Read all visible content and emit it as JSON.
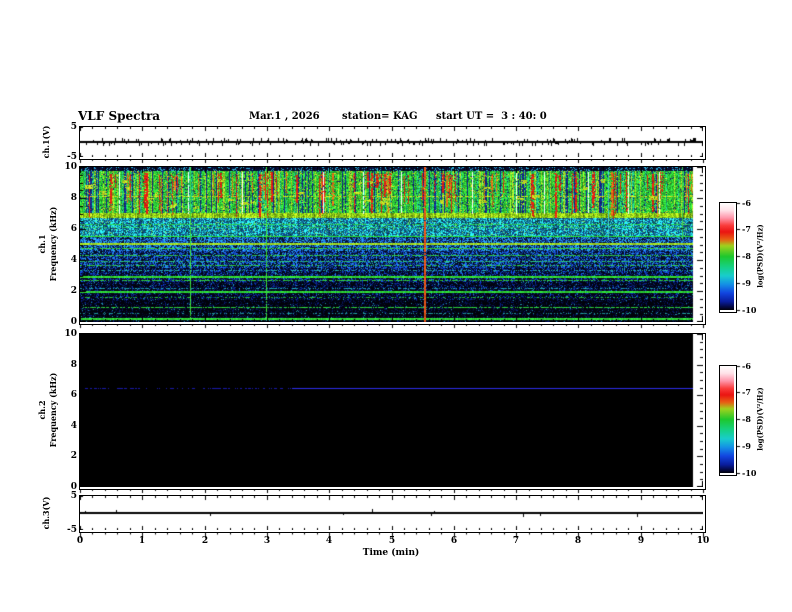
{
  "header": {
    "title": "VLF Spectra",
    "date": "Mar.1 , 2026",
    "station": "station= KAG",
    "start_ut": "start UT =  3 : 40: 0"
  },
  "axes": {
    "time_ticks": [
      "0",
      "1",
      "2",
      "3",
      "4",
      "5",
      "6",
      "7",
      "8",
      "9",
      "10"
    ],
    "time_label": "Time (min)",
    "freq_ticks": [
      "10",
      "8",
      "6",
      "4",
      "2",
      "0"
    ],
    "volt_max": "5",
    "volt_min": "-5"
  },
  "panels": {
    "ch1v": {
      "label": "ch.1(V)"
    },
    "ch1": {
      "label_line1": "ch.1",
      "label_line2": "Frequency (kHz)"
    },
    "ch2": {
      "label_line1": "ch.2",
      "label_line2": "Frequency (kHz)"
    },
    "ch3v": {
      "label": "ch.3(V)"
    }
  },
  "colorbar": {
    "ticks": [
      "-6",
      "-7",
      "-8",
      "-9",
      "-10"
    ],
    "label": "log(PSD)(V²/Hz)"
  },
  "chart_data": [
    {
      "id": "ch1_voltage",
      "type": "line",
      "title": "ch.1(V)",
      "x_range": [
        0,
        10
      ],
      "y_range": [
        -5,
        5
      ],
      "baseline_v": 0,
      "description": "flat trace at 0 V with dense small noise spikes",
      "noise_p": 0.32,
      "data_end_min": 10
    },
    {
      "id": "ch1_spectrogram",
      "type": "heatmap",
      "x_range": [
        0,
        10
      ],
      "y_range": [
        0,
        10
      ],
      "y_label": "ch.1 Frequency (kHz)",
      "data_end_min": 9.84,
      "bands": [
        {
          "f_hi": 10,
          "f_lo": 9.72,
          "base": [
            6,
            10,
            45
          ],
          "variation": 0.5,
          "fleck_p": 0.18,
          "fleck": [
            40,
            170,
            210
          ],
          "dark_p": 0,
          "dark": [
            0,
            0,
            0
          ]
        },
        {
          "f_hi": 9.72,
          "f_lo": 7.05,
          "active": true
        },
        {
          "f_hi": 7.05,
          "f_lo": 6.72,
          "base": [
            150,
            215,
            25
          ],
          "variation": 0.35,
          "fleck_p": 0,
          "fleck": [
            0,
            0,
            0
          ],
          "dark_p": 0,
          "dark": [
            0,
            0,
            0
          ]
        },
        {
          "f_hi": 6.72,
          "f_lo": 5.55,
          "base": [
            28,
            175,
            190
          ],
          "variation": 0.75,
          "fleck_p": 0.05,
          "fleck": [
            120,
            220,
            120
          ],
          "dark_p": 0.22,
          "dark": [
            15,
            70,
            150
          ]
        },
        {
          "f_hi": 5.55,
          "f_lo": 4.6,
          "base": [
            25,
            95,
            205
          ],
          "variation": 0.8,
          "fleck_p": 0.08,
          "fleck": [
            45,
            195,
            210
          ],
          "dark_p": 0.18,
          "dark": [
            4,
            10,
            40
          ]
        },
        {
          "f_hi": 4.6,
          "f_lo": 3.5,
          "base": [
            18,
            65,
            170
          ],
          "variation": 0.85,
          "fleck_p": 0.05,
          "fleck": [
            40,
            180,
            200
          ],
          "dark_p": 0.28,
          "dark": [
            3,
            8,
            30
          ]
        },
        {
          "f_hi": 3.5,
          "f_lo": 2.55,
          "base": [
            10,
            40,
            125
          ],
          "variation": 0.9,
          "fleck_p": 0.04,
          "fleck": [
            35,
            160,
            190
          ],
          "dark_p": 0.38,
          "dark": [
            2,
            5,
            22
          ]
        },
        {
          "f_hi": 2.55,
          "f_lo": 1.45,
          "base": [
            7,
            25,
            95
          ],
          "variation": 0.9,
          "fleck_p": 0.03,
          "fleck": [
            30,
            150,
            180
          ],
          "dark_p": 0.5,
          "dark": [
            1,
            3,
            15
          ]
        },
        {
          "f_hi": 1.45,
          "f_lo": 0,
          "base": [
            4,
            14,
            60
          ],
          "variation": 0.9,
          "fleck_p": 0.02,
          "fleck": [
            30,
            140,
            170
          ],
          "dark_p": 0.62,
          "dark": [
            1,
            2,
            10
          ]
        }
      ],
      "active_band": {
        "col_types": [
          {
            "p": 0.12,
            "rgb": [
              20,
              40,
              140
            ]
          },
          {
            "p": 0.3,
            "rgb": [
              30,
              185,
              130
            ]
          },
          {
            "p": 0.45,
            "rgb": [
              150,
              215,
              40
            ]
          },
          {
            "p": 1.01,
            "rgb": [
              45,
              200,
              55
            ]
          }
        ],
        "yellow_p": 0.06,
        "yellow": [
          200,
          225,
          35
        ],
        "navy_p": 0.05,
        "navy": [
          15,
          30,
          110
        ]
      },
      "h_lines": [
        {
          "f": 8.1,
          "rgb": [
            210,
            220,
            30
          ],
          "th": 1,
          "p": 0.55
        },
        {
          "f": 6.35,
          "rgb": [
            40,
            210,
            80
          ],
          "th": 1,
          "p": 0.7
        },
        {
          "f": 6.1,
          "rgb": [
            40,
            200,
            90
          ],
          "th": 1,
          "p": 0.5
        },
        {
          "f": 5.55,
          "rgb": [
            40,
            225,
            50
          ],
          "th": 1,
          "p": 1
        },
        {
          "f": 5.05,
          "rgb": [
            165,
            225,
            35
          ],
          "th": 2,
          "p": 1
        },
        {
          "f": 4.75,
          "rgb": [
            50,
            210,
            60
          ],
          "th": 1,
          "p": 0.8
        },
        {
          "f": 4.35,
          "rgb": [
            45,
            200,
            70
          ],
          "th": 1,
          "p": 0.8
        },
        {
          "f": 3.95,
          "rgb": [
            40,
            190,
            120
          ],
          "th": 1,
          "p": 0.7
        },
        {
          "f": 3.65,
          "rgb": [
            45,
            205,
            65
          ],
          "th": 1,
          "p": 0.6
        },
        {
          "f": 3.35,
          "rgb": [
            35,
            170,
            170
          ],
          "th": 1,
          "p": 0.5
        },
        {
          "f": 2.9,
          "rgb": [
            50,
            220,
            50
          ],
          "th": 2,
          "p": 1
        },
        {
          "f": 2.7,
          "rgb": [
            45,
            200,
            60
          ],
          "th": 1,
          "p": 0.7
        },
        {
          "f": 2.2,
          "rgb": [
            30,
            160,
            170
          ],
          "th": 1,
          "p": 0.45
        },
        {
          "f": 1.95,
          "rgb": [
            45,
            215,
            55
          ],
          "th": 2,
          "p": 1
        },
        {
          "f": 1.6,
          "rgb": [
            40,
            180,
            60
          ],
          "th": 1,
          "p": 0.4
        },
        {
          "f": 0.95,
          "rgb": [
            45,
            205,
            60
          ],
          "th": 1,
          "p": 0.75
        },
        {
          "f": 0.6,
          "rgb": [
            30,
            150,
            150
          ],
          "th": 1,
          "p": 0.35
        },
        {
          "f": 0.2,
          "rgb": [
            50,
            225,
            60
          ],
          "th": 2,
          "p": 1
        }
      ],
      "red_streaks": {
        "count": 90,
        "f_top": [
          9.45,
          9.7
        ],
        "f_bot": [
          6.6,
          8.8
        ],
        "red": [
          225,
          32,
          18
        ],
        "orange": [
          232,
          115,
          22
        ],
        "orange_ratio": 0.3
      },
      "white_gap_times": [
        0.62,
        1.73,
        2.6,
        3.9,
        4.55,
        5.15,
        6.3,
        7.0,
        7.45,
        8.15,
        8.8,
        9.3
      ],
      "white_gap_band": [
        7.05,
        9.7
      ],
      "yellow_blobs": {
        "count": 30,
        "f_range": [
          7.4,
          9.4
        ],
        "rgb": [
          200,
          225,
          35
        ]
      },
      "v_events": [
        {
          "t": 1.76,
          "rgb": [
            60,
            220,
            60
          ],
          "f_top": 10,
          "f_bot": 0.25,
          "w": 1
        },
        {
          "t": 2.99,
          "rgb": [
            60,
            220,
            60
          ],
          "f_top": 10,
          "f_bot": 0.25,
          "w": 1
        },
        {
          "t": 5.52,
          "rgb": [
            230,
            85,
            25
          ],
          "f_top": 10,
          "f_bot": 0,
          "w": 2
        },
        {
          "t": 8.48,
          "rgb": [
            60,
            200,
            200
          ],
          "f_top": 10,
          "f_bot": 5.4,
          "w": 1
        },
        {
          "t": 9.66,
          "rgb": [
            60,
            210,
            80
          ],
          "f_top": 10,
          "f_bot": 5.4,
          "w": 1
        }
      ]
    },
    {
      "id": "ch2_spectrogram",
      "type": "heatmap",
      "x_range": [
        0,
        10
      ],
      "y_range": [
        0,
        10
      ],
      "y_label": "ch.2 Frequency (kHz)",
      "data_end_min": 9.84,
      "background": [
        0,
        0,
        0
      ],
      "h_lines": [
        {
          "f": 6.5,
          "rgb": [
            45,
            45,
            235
          ],
          "th": 1,
          "p": 1,
          "faint_until_min": 3.4,
          "faint_rgb": [
            25,
            25,
            170
          ],
          "faint_p": 0.5
        }
      ]
    },
    {
      "id": "ch3_voltage",
      "type": "line",
      "title": "ch.3(V)",
      "x_range": [
        0,
        10
      ],
      "y_range": [
        -5,
        5
      ],
      "baseline_v": 0,
      "description": "clean flat trace at 0 V",
      "noise_p": 0.02,
      "data_end_min": 10
    },
    {
      "id": "colorbar",
      "type": "colorbar",
      "ticks": [
        -6,
        -7,
        -8,
        -9,
        -10
      ],
      "label": "log(PSD)(V²/Hz)",
      "gradient": [
        {
          "pos": 0.0,
          "rgb": [
            255,
            255,
            255
          ]
        },
        {
          "pos": 0.07,
          "rgb": [
            255,
            225,
            232
          ]
        },
        {
          "pos": 0.14,
          "rgb": [
            255,
            150,
            170
          ]
        },
        {
          "pos": 0.21,
          "rgb": [
            250,
            60,
            60
          ]
        },
        {
          "pos": 0.27,
          "rgb": [
            235,
            20,
            18
          ]
        },
        {
          "pos": 0.34,
          "rgb": [
            232,
            95,
            20
          ]
        },
        {
          "pos": 0.4,
          "rgb": [
            160,
            210,
            30
          ]
        },
        {
          "pos": 0.5,
          "rgb": [
            30,
            200,
            45
          ]
        },
        {
          "pos": 0.6,
          "rgb": [
            22,
            210,
            135
          ]
        },
        {
          "pos": 0.68,
          "rgb": [
            25,
            205,
            205
          ]
        },
        {
          "pos": 0.76,
          "rgb": [
            20,
            145,
            230
          ]
        },
        {
          "pos": 0.84,
          "rgb": [
            18,
            70,
            225
          ]
        },
        {
          "pos": 0.92,
          "rgb": [
            10,
            30,
            160
          ]
        },
        {
          "pos": 0.98,
          "rgb": [
            4,
            6,
            50
          ]
        },
        {
          "pos": 1.0,
          "rgb": [
            2,
            2,
            8
          ]
        }
      ]
    }
  ]
}
